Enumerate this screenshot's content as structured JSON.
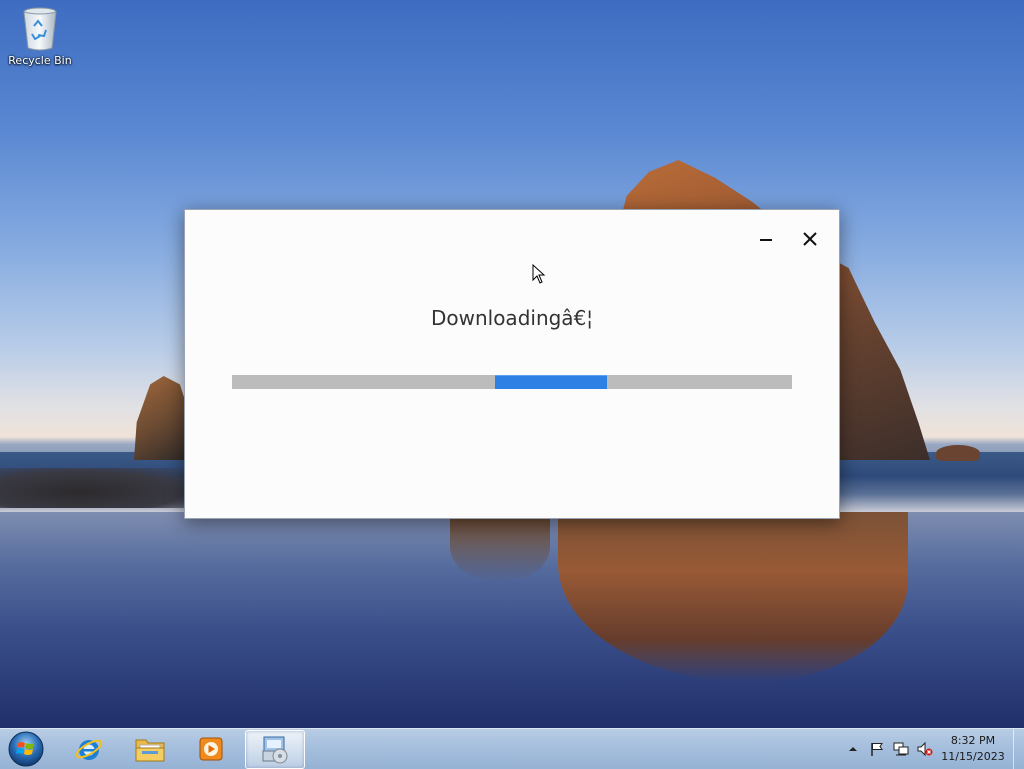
{
  "desktop": {
    "icons": [
      {
        "label": "Recycle Bin",
        "icon": "recycle-bin-icon"
      }
    ]
  },
  "dialog": {
    "title": "Downloadingâ€¦",
    "progress": {
      "mode": "indeterminate",
      "segment_start_fraction": 0.47,
      "segment_end_fraction": 0.67
    },
    "controls": {
      "minimize": "minimize-icon",
      "close": "close-icon"
    }
  },
  "taskbar": {
    "start": "windows-start-icon",
    "pinned": [
      {
        "name": "internet-explorer",
        "icon": "internet-explorer-icon"
      },
      {
        "name": "file-explorer",
        "icon": "folder-icon"
      },
      {
        "name": "media-player",
        "icon": "media-player-icon"
      },
      {
        "name": "installer",
        "icon": "installer-icon",
        "active": true
      }
    ],
    "tray": {
      "icons": [
        "show-hidden-icons-arrow",
        "action-center-flag-icon",
        "network-icon",
        "volume-muted-icon"
      ],
      "time": "8:32 PM",
      "date": "11/15/2023"
    }
  },
  "colors": {
    "progress_track": "#bcbcbc",
    "progress_fill": "#2f80e4",
    "dialog_bg": "#fcfcfc",
    "taskbar": "#a5bfdd"
  }
}
